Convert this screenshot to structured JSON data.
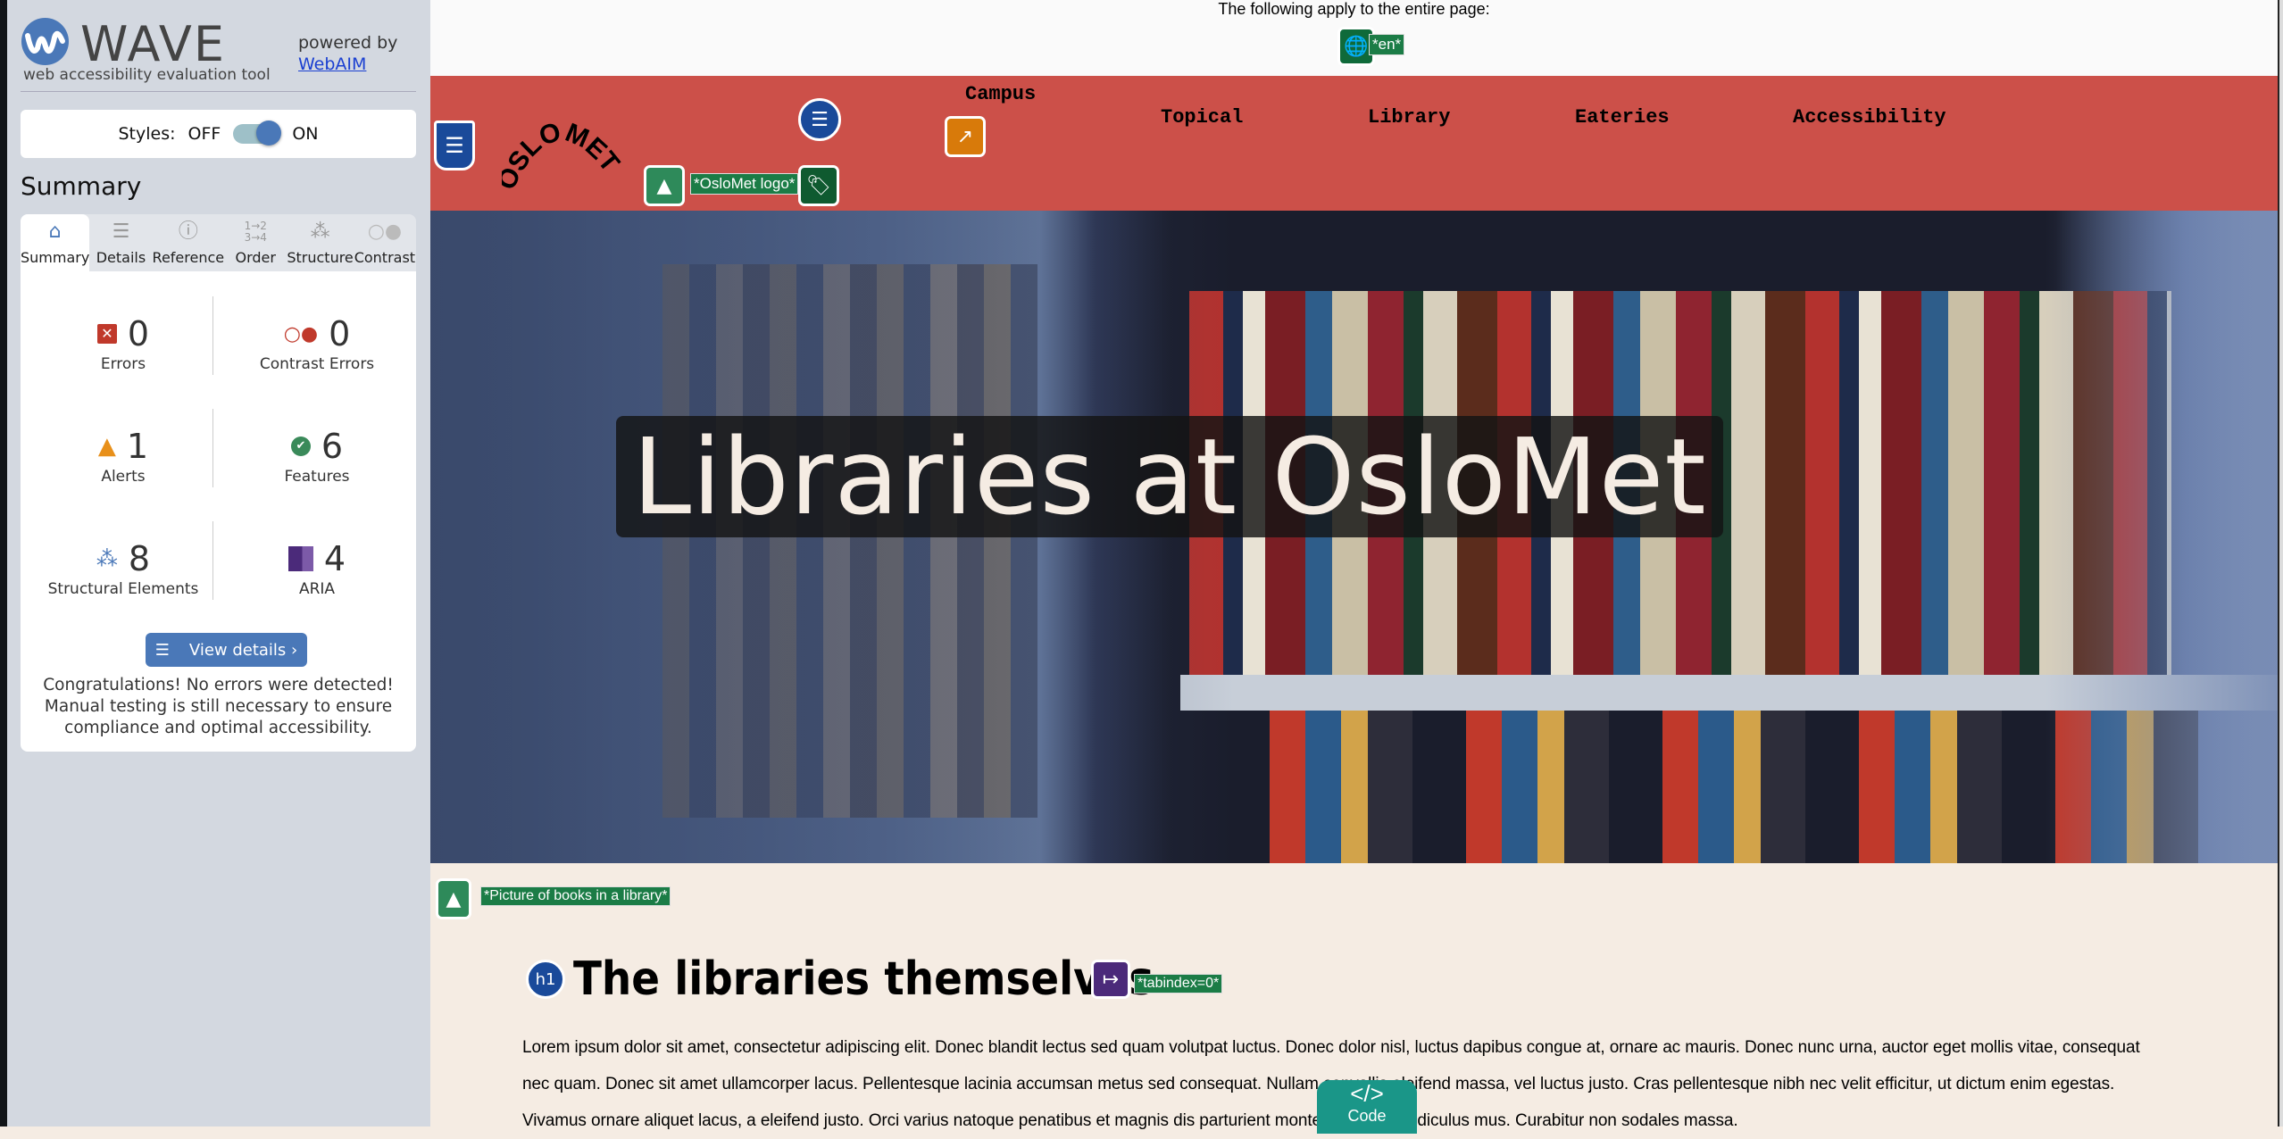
{
  "sidebar": {
    "brand": "WAVE",
    "tagline": "web accessibility evaluation tool",
    "powered_by": "powered by",
    "webaim_link": "WebAIM",
    "styles_label": "Styles:",
    "styles_off": "OFF",
    "styles_on": "ON",
    "styles_state": "on",
    "summary_heading": "Summary",
    "tabs": [
      {
        "label": "Summary",
        "icon": "home-icon",
        "active": true
      },
      {
        "label": "Details",
        "icon": "list-icon"
      },
      {
        "label": "Reference",
        "icon": "info-icon"
      },
      {
        "label": "Order",
        "icon": "order-icon"
      },
      {
        "label": "Structure",
        "icon": "structure-icon"
      },
      {
        "label": "Contrast",
        "icon": "contrast-icon"
      }
    ],
    "stats": [
      {
        "label": "Errors",
        "count": "0",
        "icon": "error-icon",
        "color": "#c0392b"
      },
      {
        "label": "Contrast Errors",
        "count": "0",
        "icon": "contrast-error-icon",
        "color": "#c0392b"
      },
      {
        "label": "Alerts",
        "count": "1",
        "icon": "alert-icon",
        "color": "#e8901a"
      },
      {
        "label": "Features",
        "count": "6",
        "icon": "feature-icon",
        "color": "#3a8a5a"
      },
      {
        "label": "Structural Elements",
        "count": "8",
        "icon": "structure-icon",
        "color": "#4a78b8"
      },
      {
        "label": "ARIA",
        "count": "4",
        "icon": "aria-icon",
        "color": "#4b2a7a"
      }
    ],
    "view_details": "View details ›",
    "congrats": "Congratulations! No errors were detected! Manual testing is still necessary to ensure compliance and optimal accessibility."
  },
  "page": {
    "applies_text": "The following apply to the entire page:",
    "lang_label": "*en*",
    "logo_text": "OSLOMET",
    "logo_alt_label": "*OsloMet logo*",
    "nav": [
      "Campus",
      "Topical",
      "Library",
      "Eateries",
      "Accessibility"
    ],
    "hero_title": "Libraries at OsloMet",
    "hero_alt_label": "*Picture of books in a library*",
    "h1_badge": "h1",
    "heading": "The libraries themselves",
    "tabindex_label": "*tabindex=0*",
    "paragraph": "Lorem ipsum dolor sit amet, consectetur adipiscing elit. Donec blandit lectus sed quam volutpat luctus. Donec dolor nisl, luctus dapibus congue at, ornare ac mauris. Donec nunc urna, auctor eget mollis vitae, consequat nec quam. Donec sit amet ullamcorper lacus. Pellentesque lacinia accumsan metus sed consequat. Nullam convallis eleifend massa, vel luctus justo. Cras pellentesque nibh nec velit efficitur, ut dictum enim egestas. Vivamus ornare aliquet lacus, a eleifend justo. Orci varius natoque penatibus et magnis dis parturient montes, nascetur ridiculus mus. Curabitur non sodales massa.",
    "code_tab": "Code"
  },
  "colors": {
    "nav_bg": "#cc5049",
    "wave_blue": "#4a78b8",
    "label_green": "#1b7c46",
    "content_bg": "#f5ece3"
  }
}
